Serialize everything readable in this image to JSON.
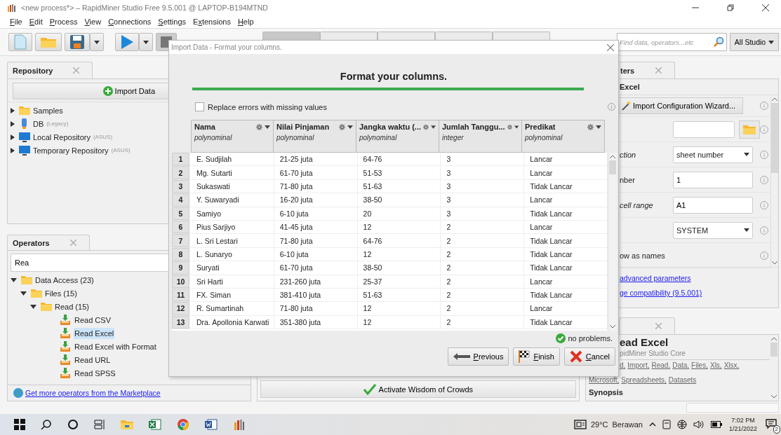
{
  "window": {
    "title": "<new process*> – RapidMiner Studio Free 9.5.001 @ LAPTOP-B194MTND"
  },
  "menu": [
    {
      "key": "F",
      "after": "ile"
    },
    {
      "key": "E",
      "after": "dit"
    },
    {
      "key": "P",
      "after": "rocess"
    },
    {
      "key": "V",
      "after": "iew"
    },
    {
      "key": "C",
      "after": "onnections"
    },
    {
      "key": "S",
      "after": "ettings"
    },
    {
      "before": "E",
      "key": "x",
      "after": "tensions"
    },
    {
      "key": "H",
      "after": "elp"
    }
  ],
  "views": {
    "tabs": [
      {
        "selected": true
      },
      {
        "selected": false
      },
      {
        "selected": false
      },
      {
        "selected": false
      },
      {
        "selected": false
      }
    ]
  },
  "search": {
    "placeholder": "Find data, operators...etc",
    "scope": "All Studio"
  },
  "repository": {
    "title": "Repository",
    "import_button": "Import Data",
    "items": [
      {
        "label": "Samples",
        "kind": "folder",
        "expanded": false
      },
      {
        "label": "DB",
        "note": "(Legacy)",
        "kind": "database",
        "expanded": false
      },
      {
        "label": "Local Repository",
        "note": "(ASUS)",
        "kind": "computer",
        "expanded": false
      },
      {
        "label": "Temporary Repository",
        "note": "(ASUS)",
        "kind": "computer",
        "expanded": false
      }
    ]
  },
  "operators": {
    "title": "Operators",
    "search_value": "Rea",
    "tree": [
      {
        "label": "Data Access (23)",
        "kind": "folder",
        "expanded": true,
        "children": [
          {
            "label": "Files (15)",
            "kind": "folder",
            "expanded": true,
            "children": [
              {
                "label": "Read (15)",
                "kind": "folder",
                "expanded": true,
                "children": [
                  {
                    "label": "Read CSV",
                    "kind": "operator",
                    "selected": false
                  },
                  {
                    "label": "Read Excel",
                    "kind": "operator",
                    "selected": true
                  },
                  {
                    "label": "Read Excel with Format",
                    "kind": "operator",
                    "selected": false
                  },
                  {
                    "label": "Read URL",
                    "kind": "operator",
                    "selected": false
                  },
                  {
                    "label": "Read SPSS",
                    "kind": "operator",
                    "selected": false
                  }
                ]
              }
            ]
          }
        ]
      }
    ],
    "marketplace_link": "Get more operators from the Marketplace"
  },
  "center": {
    "wisdom_button": "Activate Wisdom of Crowds"
  },
  "parameters": {
    "tab": "ters",
    "operator": "Excel",
    "wizard_button": "Import Configuration Wizard...",
    "rows": [
      {
        "kind": "file"
      },
      {
        "kind": "select",
        "label": "ction",
        "expert": true,
        "value": "sheet number"
      },
      {
        "kind": "text",
        "label": "nber",
        "expert": false,
        "value": "1"
      },
      {
        "kind": "text",
        "label": "cell range",
        "expert": true,
        "value": "A1"
      },
      {
        "kind": "select",
        "value": "SYSTEM"
      },
      {
        "kind": "flag",
        "label": "ow as names",
        "expert": false
      }
    ],
    "links": [
      "advanced parameters",
      "ge compatibility (9.5.001)"
    ]
  },
  "help": {
    "title": "ead Excel",
    "subtitle": "pidMiner Studio Core",
    "tag_lines": [
      [
        "d,",
        "Import,",
        "Read,",
        "Data,",
        "Files,",
        "Xls,",
        "Xlsx,"
      ],
      [
        "Microsoft,",
        "Spreadsheets,",
        "Datasets"
      ]
    ],
    "section": "Synopsis"
  },
  "dialog": {
    "title": "Import Data - Format your columns.",
    "heading": "Format your columns.",
    "replace_errors": {
      "label": "Replace errors with missing values",
      "checked": false
    },
    "columns": [
      {
        "name": "Nama",
        "type": "polynominal"
      },
      {
        "name": "Nilai Pinjaman",
        "type": "polynominal"
      },
      {
        "name": "Jangka waktu (...",
        "type": "polynominal"
      },
      {
        "name": "Jumlah Tanggu...",
        "type": "integer"
      },
      {
        "name": "Predikat",
        "type": "polynominal"
      }
    ],
    "rows": [
      {
        "number": "1",
        "cells": [
          "E. Sudjilah",
          "21-25 juta",
          "64-76",
          "3",
          "Lancar"
        ]
      },
      {
        "number": "2",
        "cells": [
          "Mg. Sutarti",
          "61-70 juta",
          "51-53",
          "3",
          "Lancar"
        ]
      },
      {
        "number": "3",
        "cells": [
          "Sukaswati",
          "71-80 juta",
          "51-63",
          "3",
          "Tidak Lancar"
        ]
      },
      {
        "number": "4",
        "cells": [
          "Y. Suwaryadi",
          "16-20 juta",
          "38-50",
          "3",
          "Lancar"
        ]
      },
      {
        "number": "5",
        "cells": [
          "Samiyo",
          "6-10 juta",
          "20",
          "3",
          "Tidak Lancar"
        ]
      },
      {
        "number": "6",
        "cells": [
          "Pius Sarjiyo",
          "41-45 juta",
          "12",
          "2",
          "Lancar"
        ]
      },
      {
        "number": "7",
        "cells": [
          "L. Sri Lestari",
          "71-80 juta",
          "64-76",
          "2",
          "Tidak Lancar"
        ]
      },
      {
        "number": "8",
        "cells": [
          "L. Sunaryo",
          "6-10 juta",
          "12",
          "2",
          "Tidak Lancar"
        ]
      },
      {
        "number": "9",
        "cells": [
          "Suryati",
          "61-70 juta",
          "38-50",
          "2",
          "Tidak Lancar"
        ]
      },
      {
        "number": "10",
        "cells": [
          "Sri Harti",
          "231-260 juta",
          "25-37",
          "2",
          "Lancar"
        ]
      },
      {
        "number": "11",
        "cells": [
          "FX. Siman",
          "381-410 juta",
          "51-63",
          "2",
          "Tidak Lancar"
        ]
      },
      {
        "number": "12",
        "cells": [
          "R. Sumartinah",
          "71-80 juta",
          "12",
          "2",
          "Lancar"
        ]
      },
      {
        "number": "13",
        "cells": [
          "Dra. Apollonia Karwati",
          "351-380 juta",
          "12",
          "2",
          "Tidak Lancar"
        ]
      }
    ],
    "status": "no problems.",
    "buttons": [
      {
        "kind": "previous",
        "key": "P",
        "after": "revious"
      },
      {
        "kind": "finish",
        "key": "F",
        "after": "inish"
      },
      {
        "kind": "cancel",
        "key": "C",
        "after": "ancel"
      }
    ]
  },
  "taskbar": {
    "temperature": "29°C",
    "weather": "Berawan",
    "time": "7:02 PM",
    "date": "1/21/2022",
    "notifications": "2"
  }
}
